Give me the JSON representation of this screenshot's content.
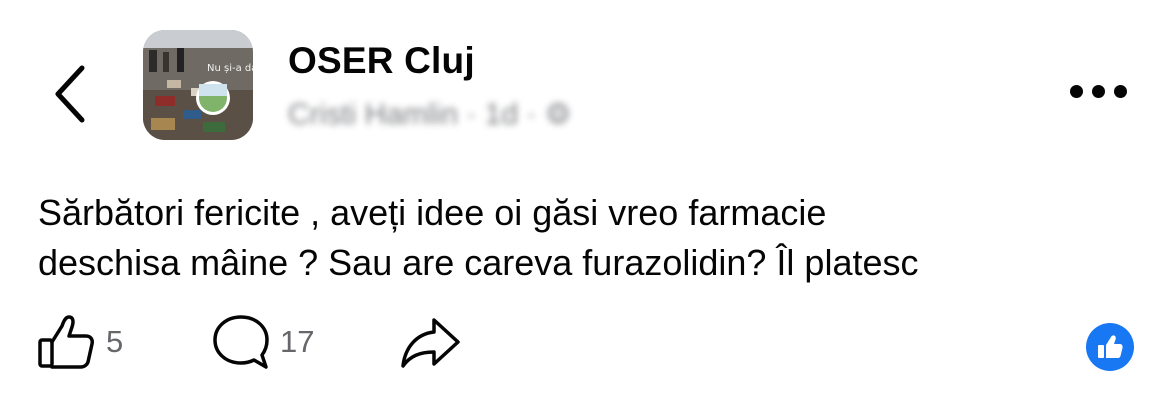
{
  "header": {
    "back_icon": "chevron-left-icon",
    "group_name": "OSER Cluj",
    "meta_text": "Cristi Hamlin · 1d · ⚙",
    "avatar_caption": "Nu și-a dat acc",
    "more_icon": "more-dots-icon"
  },
  "post": {
    "lines": [
      "Sărbători fericite , aveți idee oi găsi vreo farmacie",
      "deschisa mâine ? Sau are careva furazolidin? Îl platesc"
    ]
  },
  "actions": {
    "likes": "5",
    "comments": "17",
    "like_icon": "thumbs-up-icon",
    "comment_icon": "comment-bubble-icon",
    "share_icon": "share-arrow-icon"
  },
  "reaction": {
    "icon": "like-reaction-icon",
    "color": "#1877f2"
  },
  "colors": {
    "text": "#050505",
    "secondary": "#65676b",
    "accent": "#1877f2"
  }
}
